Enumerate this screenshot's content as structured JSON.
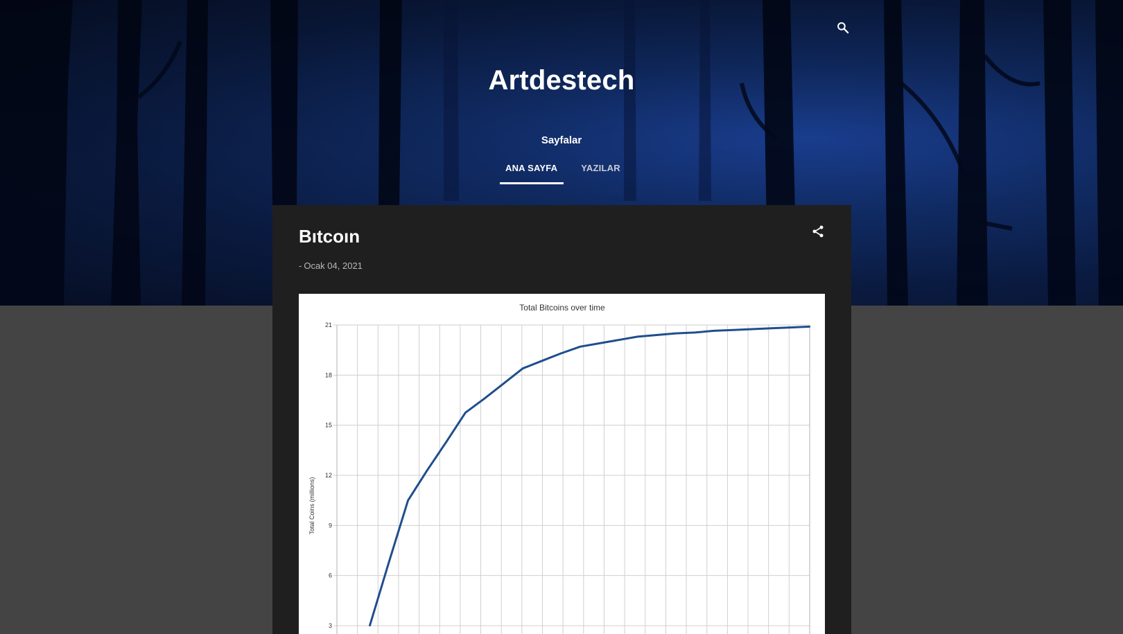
{
  "header": {
    "site_title": "Artdestech",
    "pages_label": "Sayfalar",
    "search_icon": "search-icon"
  },
  "nav": {
    "tabs": [
      {
        "label": "ANA SAYFA",
        "active": true
      },
      {
        "label": "YAZILAR",
        "active": false
      }
    ]
  },
  "post": {
    "title": "Bıtcoın",
    "date_prefix": "-",
    "date": "Ocak 04, 2021",
    "share_icon": "share-icon"
  },
  "colors": {
    "hero_blue": "#12306f",
    "page_background": "#444444",
    "card_background": "#1f1f1f",
    "line": "#1f4e8c"
  },
  "chart_data": {
    "type": "line",
    "title": "Total Bitcoins over time",
    "ylabel": "Total Coins (millions)",
    "xlabel": "",
    "ylim": [
      0,
      21
    ],
    "yticks": [
      "21",
      "18",
      "15",
      "12",
      "9",
      "6",
      "3"
    ],
    "grid": true,
    "series": [
      {
        "x": [
          0,
          1,
          2,
          3,
          4,
          5,
          6,
          7,
          8,
          9,
          10,
          11,
          12,
          13,
          14,
          15,
          16,
          17,
          18,
          19,
          20,
          21,
          22,
          23
        ],
        "values": [
          3.0,
          6.8,
          10.5,
          12.3,
          14.0,
          15.75,
          16.6,
          17.5,
          18.4,
          18.85,
          19.3,
          19.7,
          19.9,
          20.1,
          20.3,
          20.4,
          20.5,
          20.55,
          20.65,
          20.7,
          20.75,
          20.8,
          20.85,
          20.9
        ]
      }
    ]
  }
}
